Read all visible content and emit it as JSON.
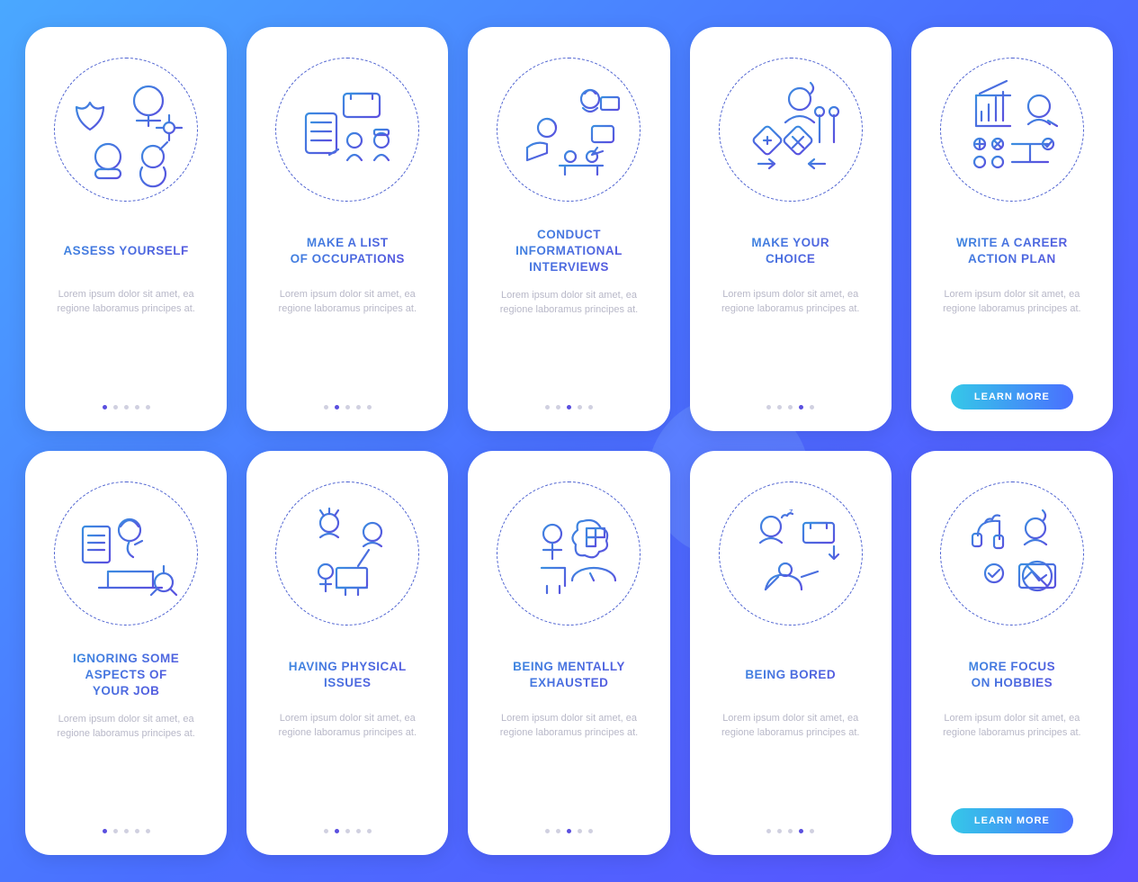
{
  "body_text": "Lorem ipsum dolor sit amet, ea regione laboramus principes at.",
  "cta_label": "LEARN MORE",
  "rows": [
    {
      "total_dots": 5,
      "screens": [
        {
          "title": "ASSESS YOURSELF",
          "active_dot": 0,
          "icon": "assess-icon"
        },
        {
          "title": "MAKE A LIST\nOF OCCUPATIONS",
          "active_dot": 1,
          "icon": "list-icon"
        },
        {
          "title": "CONDUCT\nINFORMATIONAL\nINTERVIEWS",
          "active_dot": 2,
          "icon": "interview-icon"
        },
        {
          "title": "MAKE YOUR\nCHOICE",
          "active_dot": 3,
          "icon": "choice-icon"
        },
        {
          "title": "WRITE A CAREER\nACTION PLAN",
          "active_dot": 4,
          "icon": "plan-icon",
          "cta": true
        }
      ]
    },
    {
      "total_dots": 5,
      "screens": [
        {
          "title": "IGNORING SOME\nASPECTS OF\nYOUR JOB",
          "active_dot": 0,
          "icon": "ignore-icon"
        },
        {
          "title": "HAVING PHYSICAL\nISSUES",
          "active_dot": 1,
          "icon": "physical-icon"
        },
        {
          "title": "BEING MENTALLY\nEXHAUSTED",
          "active_dot": 2,
          "icon": "mental-icon"
        },
        {
          "title": "BEING BORED",
          "active_dot": 3,
          "icon": "bored-icon"
        },
        {
          "title": "MORE FOCUS\nON HOBBIES",
          "active_dot": 4,
          "icon": "hobby-icon",
          "cta": true
        }
      ]
    }
  ],
  "colors": {
    "stroke_a": "#3a8de0",
    "stroke_b": "#5a4fdf"
  }
}
